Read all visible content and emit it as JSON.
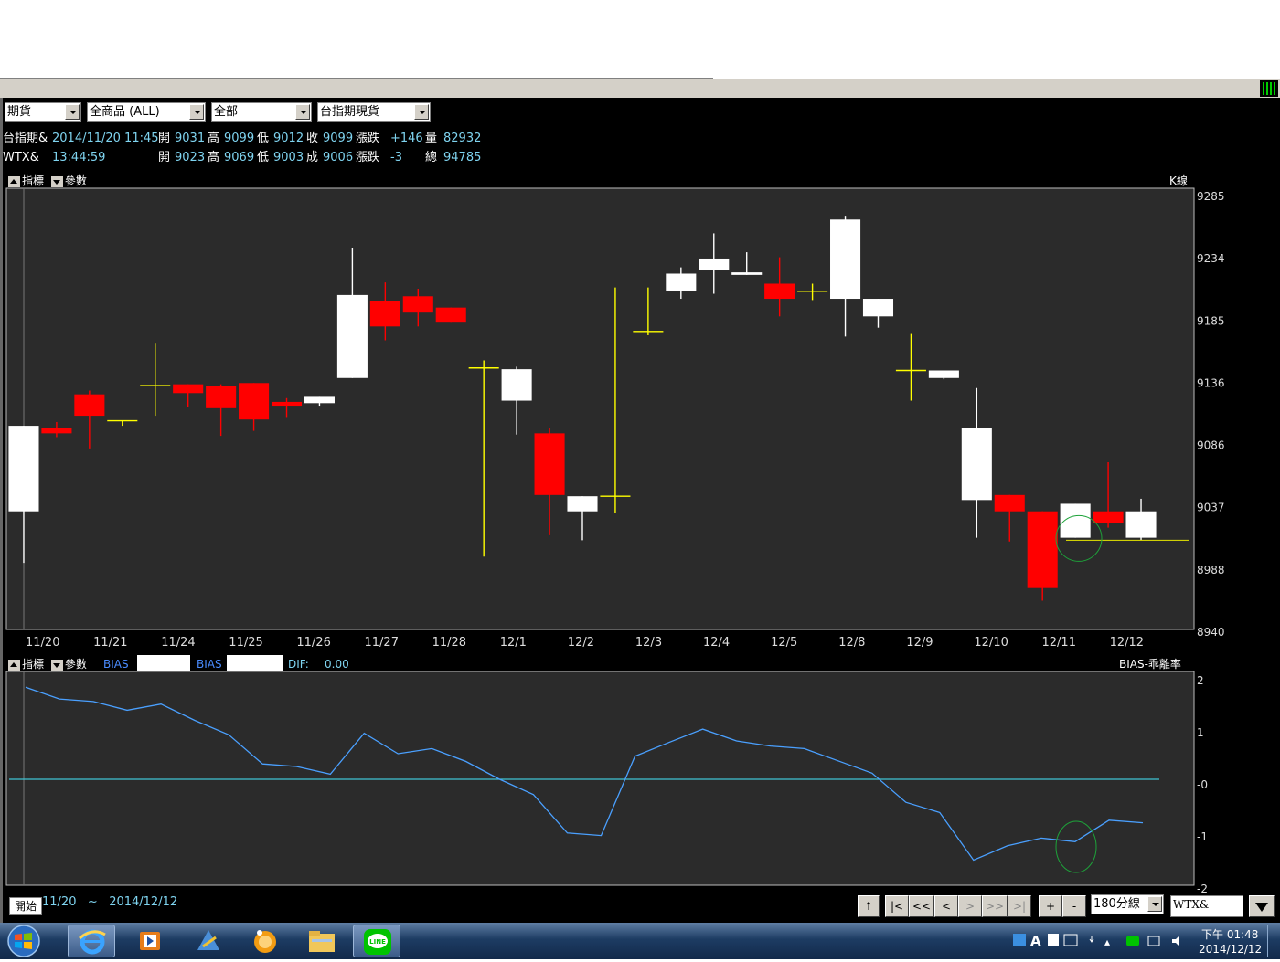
{
  "toolbar": {
    "combo1": "期貨",
    "combo2": "全商品      (ALL)",
    "combo3": "全部",
    "combo4": "台指期現貨"
  },
  "quote": {
    "row1": {
      "name": "台指期&",
      "datetime": "2014/11/20 11:45",
      "open_lbl": "開",
      "open": "9031",
      "high_lbl": "高",
      "high": "9099",
      "low_lbl": "低",
      "low": "9012",
      "close_lbl": "收",
      "close": "9099",
      "chg_lbl": "漲跌",
      "chg": "+146",
      "vol_lbl": "量",
      "vol": "82932"
    },
    "row2": {
      "name": "WTX&",
      "time": "13:44:59",
      "open_lbl": "開",
      "open": "9023",
      "high_lbl": "高",
      "high": "9069",
      "low_lbl": "低",
      "low": "9003",
      "close_lbl": "成",
      "close": "9006",
      "chg_lbl": "漲跌",
      "chg": "-3",
      "vol_lbl": "總",
      "vol": "94785"
    }
  },
  "panels": {
    "main": {
      "tab1": "指標",
      "tab2": "參數",
      "title": "K線"
    },
    "sub": {
      "tab1": "指標",
      "tab2": "參數",
      "bias1": "BIAS",
      "bias2": "BIAS",
      "dif_lbl": "DIF:",
      "dif_val": "0.00",
      "title": "BIAS-乖離率"
    }
  },
  "chart_data": [
    {
      "type": "candlestick",
      "title": "K線",
      "ylim": [
        8940,
        9285
      ],
      "yticks": [
        "9285",
        "9234",
        "9185",
        "9136",
        "9086",
        "9037",
        "8988",
        "8940"
      ],
      "date_labels": [
        "11/20",
        "11/21",
        "11/24",
        "11/25",
        "11/26",
        "11/27",
        "11/28",
        "12/1",
        "12/2",
        "12/3",
        "12/4",
        "12/5",
        "12/8",
        "12/9",
        "12/10",
        "12/11",
        "12/12"
      ],
      "colors": {
        "up": "#ffffff",
        "down": "#ff0000",
        "flat": "#ffff00"
      },
      "candles": [
        {
          "o": 9031,
          "h": 9031,
          "l": 8990,
          "c": 9099
        },
        {
          "o": 9097,
          "h": 9102,
          "l": 9090,
          "c": 9093
        },
        {
          "o": 9124,
          "h": 9127,
          "l": 9081,
          "c": 9107
        },
        {
          "o": 9103,
          "h": 9103,
          "l": 9099,
          "c": 9103
        },
        {
          "o": 9131,
          "h": 9165,
          "l": 9107,
          "c": 9131
        },
        {
          "o": 9132,
          "h": 9132,
          "l": 9114,
          "c": 9125
        },
        {
          "o": 9131,
          "h": 9132,
          "l": 9091,
          "c": 9113
        },
        {
          "o": 9133,
          "h": 9132,
          "l": 9095,
          "c": 9104
        },
        {
          "o": 9118,
          "h": 9121,
          "l": 9106,
          "c": 9115
        },
        {
          "o": 9117,
          "h": 9122,
          "l": 9115,
          "c": 9122
        },
        {
          "o": 9137,
          "h": 9240,
          "l": 9138,
          "c": 9203
        },
        {
          "o": 9198,
          "h": 9213,
          "l": 9167,
          "c": 9178
        },
        {
          "o": 9202,
          "h": 9208,
          "l": 9178,
          "c": 9189
        },
        {
          "o": 9193,
          "h": 9193,
          "l": 9183,
          "c": 9181
        },
        {
          "o": 9145,
          "h": 9151,
          "l": 8995,
          "c": 9145
        },
        {
          "o": 9119,
          "h": 9146,
          "l": 9092,
          "c": 9144
        },
        {
          "o": 9093,
          "h": 9097,
          "l": 9012,
          "c": 9044
        },
        {
          "o": 9031,
          "h": 9034,
          "l": 9008,
          "c": 9043
        },
        {
          "o": 9043,
          "h": 9209,
          "l": 9030,
          "c": 9043
        },
        {
          "o": 9174,
          "h": 9209,
          "l": 9171,
          "c": 9174
        },
        {
          "o": 9206,
          "h": 9225,
          "l": 9200,
          "c": 9220
        },
        {
          "o": 9223,
          "h": 9252,
          "l": 9204,
          "c": 9232
        },
        {
          "o": 9219,
          "h": 9237,
          "l": 9221,
          "c": 9221
        },
        {
          "o": 9212,
          "h": 9233,
          "l": 9186,
          "c": 9200
        },
        {
          "o": 9206,
          "h": 9212,
          "l": 9199,
          "c": 9206
        },
        {
          "o": 9200,
          "h": 9266,
          "l": 9170,
          "c": 9263
        },
        {
          "o": 9186,
          "h": 9200,
          "l": 9177,
          "c": 9200
        },
        {
          "o": 9143,
          "h": 9172,
          "l": 9119,
          "c": 9143
        },
        {
          "o": 9137,
          "h": 9142,
          "l": 9136,
          "c": 9143
        },
        {
          "o": 9040,
          "h": 9129,
          "l": 9010,
          "c": 9097
        },
        {
          "o": 9044,
          "h": 9044,
          "l": 9007,
          "c": 9031
        },
        {
          "o": 9031,
          "h": 9031,
          "l": 8960,
          "c": 8970
        },
        {
          "o": 9010,
          "h": 9037,
          "l": 9010,
          "c": 9037
        },
        {
          "o": 9031,
          "h": 9070,
          "l": 9018,
          "c": 9022
        },
        {
          "o": 9010,
          "h": 9041,
          "l": 9008,
          "c": 9031
        }
      ],
      "reference_line": 9008
    },
    {
      "type": "line",
      "title": "BIAS-乖離率",
      "ylim": [
        -2,
        2
      ],
      "yticks": [
        "2",
        "1",
        "-0",
        "-1",
        "-2"
      ],
      "zero_line": 0,
      "series": [
        {
          "name": "BIAS",
          "color": "#4aa0ff",
          "values": [
            1.8,
            1.57,
            1.52,
            1.35,
            1.47,
            1.15,
            0.87,
            0.3,
            0.25,
            0.1,
            0.9,
            0.5,
            0.6,
            0.35,
            0.0,
            -0.3,
            -1.05,
            -1.1,
            0.45,
            0.72,
            0.98,
            0.75,
            0.65,
            0.6,
            0.36,
            0.12,
            -0.45,
            -0.65,
            -1.58,
            -1.3,
            -1.15,
            -1.22,
            -0.8,
            -0.85
          ]
        }
      ]
    }
  ],
  "bottom": {
    "start_label": "開始",
    "range_from": "11/20",
    "range_sep": "~",
    "range_to": "2014/12/12",
    "nav": [
      "↑",
      "|<",
      "<<",
      "<",
      ">",
      ">>",
      ">|",
      "+",
      "-"
    ],
    "interval": "180分線",
    "symbol": "WTX&"
  },
  "taskbar": {
    "time": "下午 01:48",
    "date": "2014/12/12",
    "apps": [
      "windows-start-icon",
      "internet-explorer-icon",
      "media-player-icon",
      "app-icon",
      "browser-icon",
      "file-explorer-icon",
      "line-icon"
    ]
  }
}
